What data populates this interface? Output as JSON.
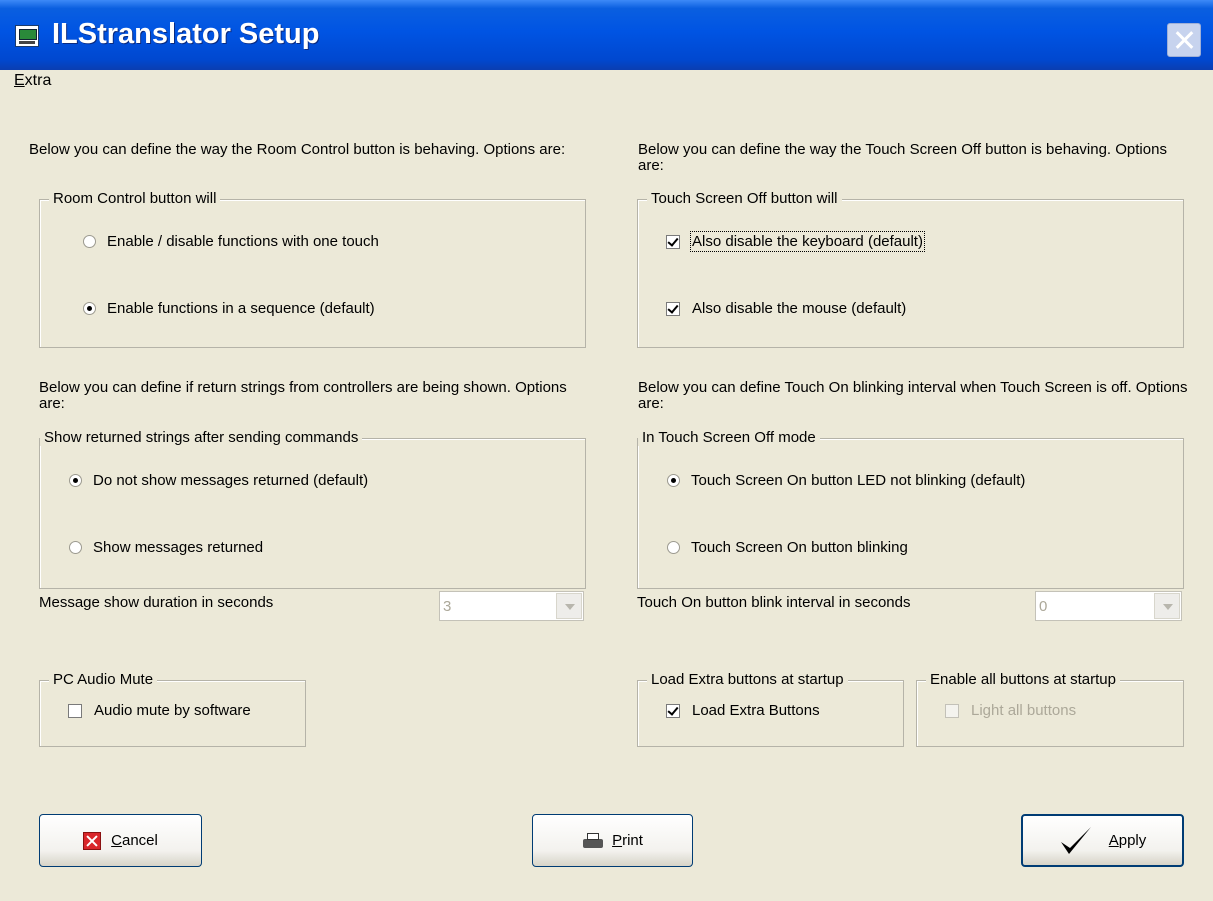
{
  "window": {
    "title": "ILStranslator Setup"
  },
  "menu": {
    "extra": "Extra"
  },
  "room_control": {
    "description": "Below you can define the way the Room Control button is behaving. Options are:",
    "legend": "Room Control button will",
    "options": [
      "Enable / disable functions with one touch",
      "Enable functions in a sequence (default)"
    ],
    "selected": 1
  },
  "touch_screen_off": {
    "description": "Below you can define the way the Touch Screen Off button is behaving. Options are:",
    "legend": "Touch Screen Off button will",
    "options": [
      "Also disable the keyboard (default)",
      "Also disable the mouse (default)"
    ],
    "checked": [
      true,
      true
    ]
  },
  "return_strings": {
    "description": "Below you can define if return strings from controllers are being shown. Options are:",
    "legend": "Show returned strings after sending commands",
    "options": [
      "Do not show messages returned (default)",
      "Show messages returned"
    ],
    "selected": 0,
    "duration_label": "Message show duration in seconds",
    "duration_value": "3"
  },
  "touch_on_blink": {
    "description": "Below you can define Touch On blinking interval when Touch Screen is off. Options are:",
    "legend": "In Touch Screen Off mode",
    "options": [
      "Touch Screen On button LED not blinking (default)",
      "Touch Screen On button blinking"
    ],
    "selected": 0,
    "interval_label": "Touch On button blink interval in seconds",
    "interval_value": "0"
  },
  "pc_audio": {
    "legend": "PC Audio Mute",
    "option": "Audio mute by software",
    "checked": false
  },
  "extra_buttons": {
    "legend": "Load Extra buttons at startup",
    "option": "Load Extra Buttons",
    "checked": true
  },
  "enable_all": {
    "legend": "Enable all buttons at startup",
    "option": "Light all buttons",
    "checked": false,
    "disabled": true
  },
  "buttons": {
    "cancel": "Cancel",
    "print": "Print",
    "apply": "Apply"
  }
}
